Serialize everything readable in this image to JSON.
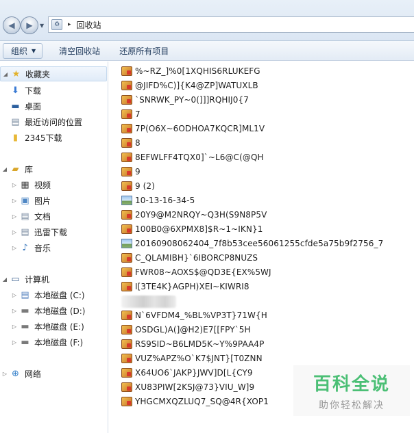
{
  "address": {
    "location": "回收站",
    "separator": "▸"
  },
  "toolbar": {
    "organize_label": "组织",
    "clear_label": "清空回收站",
    "restore_label": "还原所有项目"
  },
  "navigation": {
    "favorites": {
      "label": "收藏夹",
      "items": [
        "下载",
        "桌面",
        "最近访问的位置",
        "2345下载"
      ]
    },
    "library": {
      "label": "库",
      "items": [
        "视频",
        "图片",
        "文档",
        "迅雷下载",
        "音乐"
      ]
    },
    "computer": {
      "label": "计算机",
      "items": [
        "本地磁盘 (C:)",
        "本地磁盘 (D:)",
        "本地磁盘 (E:)",
        "本地磁盘 (F:)"
      ]
    },
    "network": {
      "label": "网络"
    }
  },
  "files": [
    {
      "name": "%~RZ_]%0[1XQHIS6RLUKEFG",
      "icon": "app-icon"
    },
    {
      "name": "@JIFD%C)]{K4@ZP]WATUXLB",
      "icon": "app-icon"
    },
    {
      "name": "`SNRWK_PY~0(]]]RQHIJ0{7",
      "icon": "app-icon"
    },
    {
      "name": "7",
      "icon": "app-icon"
    },
    {
      "name": "7P(O6X~6ODHOA7KQCR]ML1V",
      "icon": "app-icon"
    },
    {
      "name": "8",
      "icon": "app-icon"
    },
    {
      "name": "8EFWLFF4TQX0]`~L6@C(@QH",
      "icon": "app-icon"
    },
    {
      "name": "9",
      "icon": "app-icon"
    },
    {
      "name": "9 (2)",
      "icon": "app-icon"
    },
    {
      "name": "10-13-16-34-5",
      "icon": "image-icon"
    },
    {
      "name": "20Y9@M2NRQY~Q3H(S9N8P5V",
      "icon": "app-icon"
    },
    {
      "name": "100B0@6XPMX8]$R~1~IKN}1",
      "icon": "app-icon"
    },
    {
      "name": "20160908062404_7f8b53cee56061255cfde5a75b9f2756_7",
      "icon": "image-icon"
    },
    {
      "name": "C_QLAMIBH}`6IBORCP8NUZS",
      "icon": "app-icon"
    },
    {
      "name": "FWR08~AOXS$@QD3E{EX%5WJ",
      "icon": "app-icon"
    },
    {
      "name": "I[3TE4K}AGPH)XEI~KIWRI8",
      "icon": "app-icon"
    },
    {
      "name": "N`6VFDM4_%BL%VP3T}71W{H",
      "icon": "app-icon"
    },
    {
      "name": "OSDGL)A(]@H2)E7[[FPY`5H",
      "icon": "app-icon"
    },
    {
      "name": "RS9SID~B6LMD5K~Y%9PAA4P",
      "icon": "app-icon"
    },
    {
      "name": "VUZ%APZ%O`K7$JNT}[T0ZNN",
      "icon": "app-icon"
    },
    {
      "name": "X64UO6`JAKP}JWV]D[L{CY9",
      "icon": "app-icon"
    },
    {
      "name": "XU83PIW[2KSJ@73}VIU_W]9",
      "icon": "app-icon"
    },
    {
      "name": "YHGCMXQZLUQ7_SQ@4R{XOP1",
      "icon": "app-icon"
    }
  ],
  "watermark": {
    "main": "百科全说",
    "sub": "助你轻松解决"
  },
  "colors": {
    "accent": "#1e395b",
    "watermark_green": "#4bbf75"
  }
}
